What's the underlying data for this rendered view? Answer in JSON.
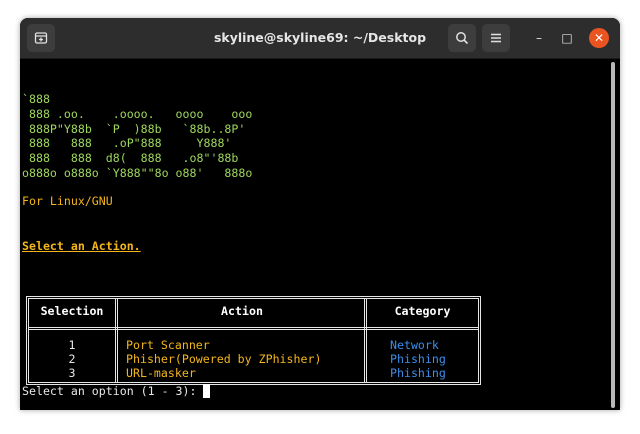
{
  "window": {
    "title": "skyline@skyline69: ~/Desktop",
    "controls": [
      "–",
      "□",
      "✕"
    ]
  },
  "colors": {
    "ascii": "#9ed65c",
    "accent_yellow": "#f4b61b",
    "category_blue": "#3b8eea",
    "close_button": "#e95420"
  },
  "terminal": {
    "ascii_art": "`888\n 888 .oo.    .oooo.   oooo    ooo\n 888P\"Y88b  `P  )88b   `88b..8P'\n 888   888   .oP\"888     Y888'\n 888   888  d8(  888   .o8\"'88b\no888o o888o `Y888\"\"8o o88'   888o",
    "tagline": "For Linux/GNU",
    "select_action": "Select an Action.",
    "table": {
      "headers": {
        "selection": "Selection",
        "action": "Action",
        "category": "Category"
      },
      "rows": [
        {
          "num": "1",
          "action": "Port Scanner",
          "category": "Network"
        },
        {
          "num": "2",
          "action": "Phisher(Powered by ZPhisher)",
          "category": "Phishing"
        },
        {
          "num": "3",
          "action": "URL-masker",
          "category": "Phishing"
        }
      ]
    },
    "prompt": "Select an option (1 - 3): "
  }
}
